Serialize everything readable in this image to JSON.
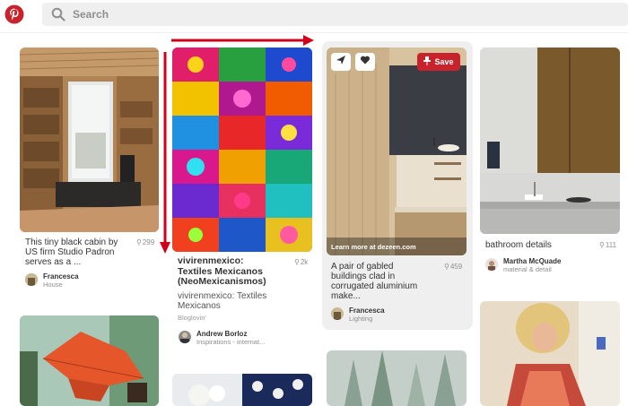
{
  "search": {
    "placeholder": "Search"
  },
  "pins": {
    "cabin": {
      "title": "This tiny black cabin by US firm Studio Padron serves as a...",
      "title_l1": "This tiny black cabin by",
      "title_l2": "US firm Studio Padron",
      "title_l3": "serves as a ...",
      "repins": "299",
      "user": "Francesca",
      "board": "House"
    },
    "textiles": {
      "title_l1": "vivirenmexico:",
      "title_l2": "Textiles Mexicanos",
      "title_l3": "(NeoMexicanismos)",
      "repins": "2k",
      "desc_l1": "vivirenmexico: Textiles",
      "desc_l2": "Mexicanos",
      "source": "Bloglovin'",
      "user": "Andrew Borloz",
      "board": "Inspirations - internat..."
    },
    "gabled": {
      "save_label": "Save",
      "learn_more": "Learn more at dezeen.com",
      "title_l1": "A pair of gabled",
      "title_l2": "buildings clad in",
      "title_l3": "corrugated aluminium",
      "title_l4": "make...",
      "repins": "459",
      "user": "Francesca",
      "board": "Lighting"
    },
    "bathroom": {
      "title": "bathroom details",
      "repins": "111",
      "user": "Martha McQuade",
      "board": "material & detail"
    }
  },
  "colors": {
    "brand": "#c8232c",
    "arrow": "#d0021b"
  },
  "icons": [
    "pinterest-logo-icon",
    "search-icon",
    "send-icon",
    "heart-icon",
    "pin-icon"
  ]
}
